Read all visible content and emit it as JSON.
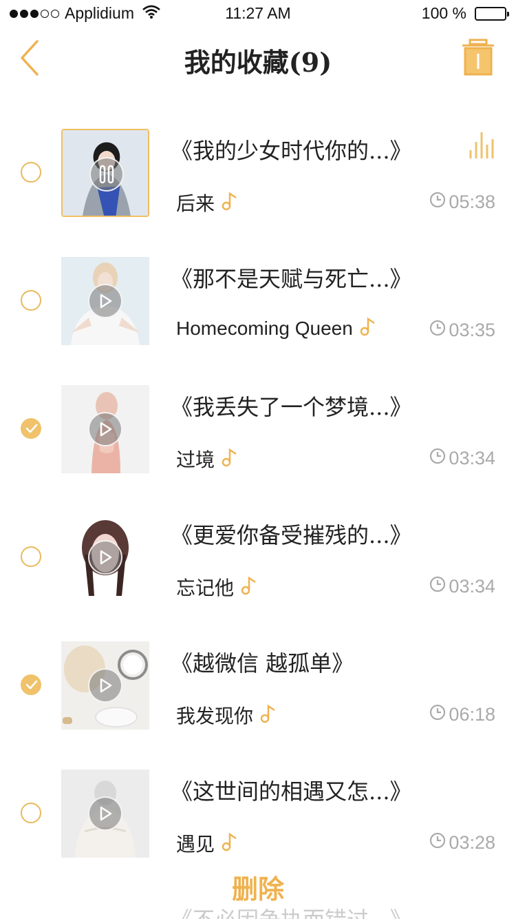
{
  "status_bar": {
    "carrier": "Applidium",
    "time": "11:27 AM",
    "battery": "100 %"
  },
  "header": {
    "title": "我的收藏(9)"
  },
  "songs": [
    {
      "title": "《我的少女时代你的...》",
      "artist": "后来",
      "duration": "05:38",
      "checked": false,
      "playing": true
    },
    {
      "title": "《那不是天赋与死亡...》",
      "artist": "Homecoming Queen",
      "duration": "03:35",
      "checked": false,
      "playing": false
    },
    {
      "title": "《我丢失了一个梦境...》",
      "artist": "过境",
      "duration": "03:34",
      "checked": true,
      "playing": false
    },
    {
      "title": "《更爱你备受摧残的...》",
      "artist": "忘记他",
      "duration": "03:34",
      "checked": false,
      "playing": false
    },
    {
      "title": "《越微信  越孤单》",
      "artist": "我发现你",
      "duration": "06:18",
      "checked": true,
      "playing": false
    },
    {
      "title": "《这世间的相遇又怎...》",
      "artist": "遇见",
      "duration": "03:28",
      "checked": false,
      "playing": false
    }
  ],
  "bottom": {
    "delete_label": "删除",
    "peek_title": "《不必因争执而错过...》"
  },
  "colors": {
    "accent": "#efb24f",
    "radio": "#e9b95c"
  }
}
